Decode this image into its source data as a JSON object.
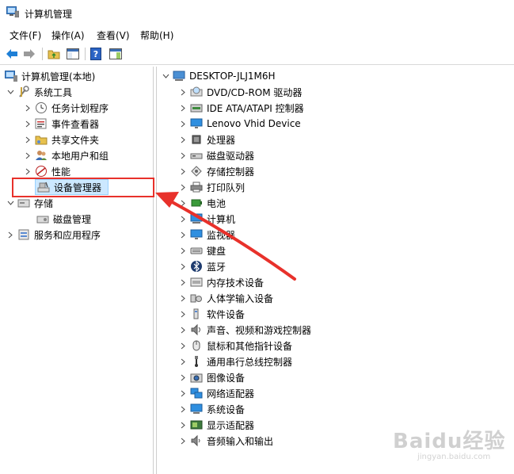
{
  "window": {
    "title": "计算机管理"
  },
  "menu": [
    "文件(F)",
    "操作(A)",
    "查看(V)",
    "帮助(H)"
  ],
  "left_tree": {
    "root": "计算机管理(本地)",
    "system_tools": "系统工具",
    "system_tools_children": [
      "任务计划程序",
      "事件查看器",
      "共享文件夹",
      "本地用户和组",
      "性能",
      "设备管理器"
    ],
    "storage": "存储",
    "storage_children": [
      "磁盘管理"
    ],
    "services": "服务和应用程序"
  },
  "right_tree": {
    "root": "DESKTOP-JLJ1M6H",
    "devices": [
      {
        "label": "DVD/CD-ROM 驱动器",
        "icon": "dvd-drive-icon"
      },
      {
        "label": "IDE ATA/ATAPI 控制器",
        "icon": "ide-controller-icon"
      },
      {
        "label": "Lenovo Vhid Device",
        "icon": "monitor-icon"
      },
      {
        "label": "处理器",
        "icon": "processor-icon"
      },
      {
        "label": "磁盘驱动器",
        "icon": "disk-drive-icon"
      },
      {
        "label": "存储控制器",
        "icon": "storage-controller-icon"
      },
      {
        "label": "打印队列",
        "icon": "printer-icon"
      },
      {
        "label": "电池",
        "icon": "battery-icon"
      },
      {
        "label": "计算机",
        "icon": "computer-icon"
      },
      {
        "label": "监视器",
        "icon": "monitor-icon"
      },
      {
        "label": "键盘",
        "icon": "keyboard-icon"
      },
      {
        "label": "蓝牙",
        "icon": "bluetooth-icon"
      },
      {
        "label": "内存技术设备",
        "icon": "memory-device-icon"
      },
      {
        "label": "人体学输入设备",
        "icon": "hid-icon"
      },
      {
        "label": "软件设备",
        "icon": "software-device-icon"
      },
      {
        "label": "声音、视频和游戏控制器",
        "icon": "speaker-icon"
      },
      {
        "label": "鼠标和其他指针设备",
        "icon": "mouse-icon"
      },
      {
        "label": "通用串行总线控制器",
        "icon": "usb-icon"
      },
      {
        "label": "图像设备",
        "icon": "camera-icon"
      },
      {
        "label": "网络适配器",
        "icon": "network-adapter-icon"
      },
      {
        "label": "系统设备",
        "icon": "system-device-icon"
      },
      {
        "label": "显示适配器",
        "icon": "display-adapter-icon"
      },
      {
        "label": "音频输入和输出",
        "icon": "audio-io-icon"
      }
    ]
  },
  "watermark": {
    "text": "Baidu经验",
    "url": "jingyan.baidu.com"
  },
  "colors": {
    "selection": "#cce8ff",
    "callout": "#e8312b",
    "back_arrow": "#1e7fd6"
  }
}
